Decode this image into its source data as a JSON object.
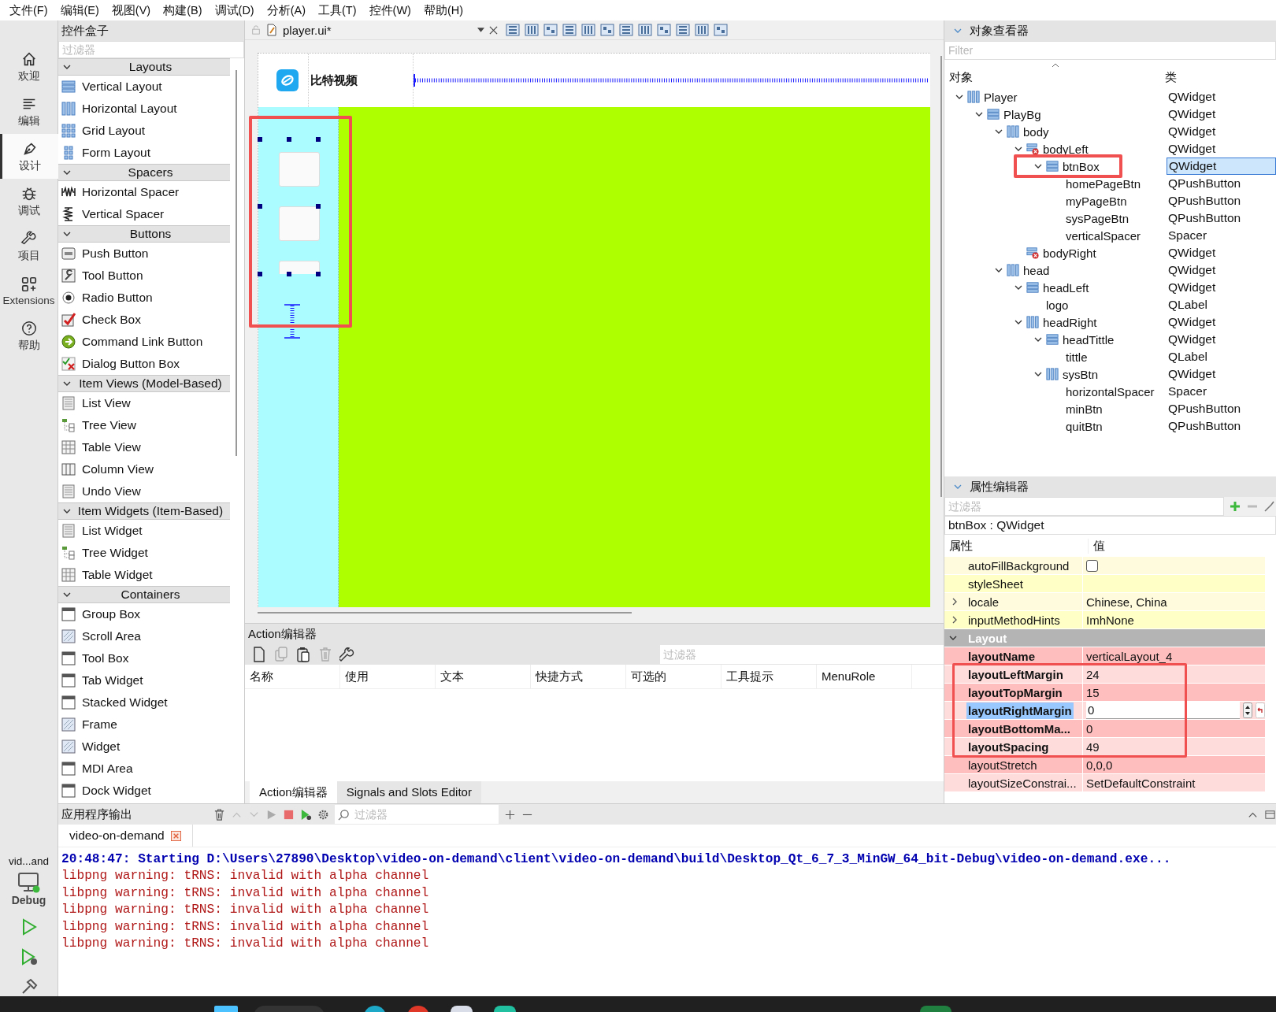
{
  "menu": [
    "文件(F)",
    "编辑(E)",
    "视图(V)",
    "构建(B)",
    "调试(D)",
    "分析(A)",
    "工具(T)",
    "控件(W)",
    "帮助(H)"
  ],
  "mode_bar": {
    "items": [
      {
        "label": "欢迎",
        "kind": "home",
        "selected": false
      },
      {
        "label": "编辑",
        "kind": "edit",
        "selected": false
      },
      {
        "label": "设计",
        "kind": "design",
        "selected": true
      },
      {
        "label": "调试",
        "kind": "debug",
        "selected": false
      },
      {
        "label": "项目",
        "kind": "project",
        "selected": false
      },
      {
        "label": "Extensions",
        "kind": "extensions",
        "selected": false
      },
      {
        "label": "帮助",
        "kind": "help",
        "selected": false
      }
    ],
    "target": "vid...and",
    "build": "Debug"
  },
  "widget_box": {
    "title": "控件盒子",
    "filter": {
      "placeholder": "过滤器"
    },
    "categories": [
      {
        "label": "Layouts",
        "expanded": true,
        "items": [
          {
            "label": "Vertical Layout",
            "kind": "vlayout"
          },
          {
            "label": "Horizontal Layout",
            "kind": "hlayout"
          },
          {
            "label": "Grid Layout",
            "kind": "grid"
          },
          {
            "label": "Form Layout",
            "kind": "form"
          }
        ]
      },
      {
        "label": "Spacers",
        "expanded": true,
        "items": [
          {
            "label": "Horizontal Spacer",
            "kind": "hspacer"
          },
          {
            "label": "Vertical Spacer",
            "kind": "vspacer"
          }
        ]
      },
      {
        "label": "Buttons",
        "expanded": true,
        "items": [
          {
            "label": "Push Button",
            "kind": "push"
          },
          {
            "label": "Tool Button",
            "kind": "tool"
          },
          {
            "label": "Radio Button",
            "kind": "radio"
          },
          {
            "label": "Check Box",
            "kind": "check"
          },
          {
            "label": "Command Link Button",
            "kind": "command"
          },
          {
            "label": "Dialog Button Box",
            "kind": "dialog"
          }
        ]
      },
      {
        "label": "Item Views (Model-Based)",
        "expanded": true,
        "items": [
          {
            "label": "List View",
            "kind": "list"
          },
          {
            "label": "Tree View",
            "kind": "tree"
          },
          {
            "label": "Table View",
            "kind": "table"
          },
          {
            "label": "Column View",
            "kind": "column"
          },
          {
            "label": "Undo View",
            "kind": "list"
          }
        ]
      },
      {
        "label": "Item Widgets (Item-Based)",
        "expanded": true,
        "items": [
          {
            "label": "List Widget",
            "kind": "list"
          },
          {
            "label": "Tree Widget",
            "kind": "tree"
          },
          {
            "label": "Table Widget",
            "kind": "table"
          }
        ]
      },
      {
        "label": "Containers",
        "expanded": true,
        "items": [
          {
            "label": "Group Box",
            "kind": "window"
          },
          {
            "label": "Scroll Area",
            "kind": "frame"
          },
          {
            "label": "Tool Box",
            "kind": "window"
          },
          {
            "label": "Tab Widget",
            "kind": "window"
          },
          {
            "label": "Stacked Widget",
            "kind": "window"
          },
          {
            "label": "Frame",
            "kind": "frame"
          },
          {
            "label": "Widget",
            "kind": "frame"
          },
          {
            "label": "MDI Area",
            "kind": "window"
          },
          {
            "label": "Dock Widget",
            "kind": "window"
          }
        ]
      }
    ]
  },
  "form_editor": {
    "file_tab": "player.ui*",
    "form": {
      "title": "比特视频"
    }
  },
  "action_editor": {
    "title": "Action编辑器",
    "filter": {
      "placeholder": "过滤器"
    },
    "columns": [
      "名称",
      "使用",
      "文本",
      "快捷方式",
      "可选的",
      "工具提示",
      "MenuRole"
    ],
    "tabs": [
      {
        "label": "Action编辑器",
        "selected": true
      },
      {
        "label": "Signals and Slots Editor",
        "selected": false
      }
    ]
  },
  "object_inspector": {
    "title": "对象查看器",
    "filter": {
      "placeholder": "Filter"
    },
    "columns": [
      "对象",
      "类"
    ],
    "tree": [
      {
        "name": "Player",
        "class": "QWidget",
        "kind": "horizontal",
        "expanded": true,
        "selected": false,
        "children": [
          {
            "name": "PlayBg",
            "class": "QWidget",
            "kind": "vertical",
            "expanded": true,
            "selected": false,
            "children": [
              {
                "name": "body",
                "class": "QWidget",
                "kind": "horizontal",
                "expanded": true,
                "selected": false,
                "children": [
                  {
                    "name": "bodyLeft",
                    "class": "QWidget",
                    "kind": "broken",
                    "expanded": true,
                    "selected": false,
                    "children": [
                      {
                        "name": "btnBox",
                        "class": "QWidget",
                        "kind": "vertical",
                        "expanded": true,
                        "selected": true,
                        "children": [
                          {
                            "name": "homePageBtn",
                            "class": "QPushButton",
                            "selected": false
                          },
                          {
                            "name": "myPageBtn",
                            "class": "QPushButton",
                            "selected": false
                          },
                          {
                            "name": "sysPageBtn",
                            "class": "QPushButton",
                            "selected": false
                          },
                          {
                            "name": "verticalSpacer",
                            "class": "Spacer",
                            "selected": false
                          }
                        ]
                      }
                    ]
                  },
                  {
                    "name": "bodyRight",
                    "class": "QWidget",
                    "kind": "broken",
                    "selected": false
                  }
                ]
              },
              {
                "name": "head",
                "class": "QWidget",
                "kind": "horizontal",
                "expanded": true,
                "selected": false,
                "children": [
                  {
                    "name": "headLeft",
                    "class": "QWidget",
                    "kind": "vertical",
                    "expanded": true,
                    "selected": false,
                    "children": [
                      {
                        "name": "logo",
                        "class": "QLabel",
                        "selected": false
                      }
                    ]
                  },
                  {
                    "name": "headRight",
                    "class": "QWidget",
                    "kind": "horizontal",
                    "expanded": true,
                    "selected": false,
                    "children": [
                      {
                        "name": "headTittle",
                        "class": "QWidget",
                        "kind": "vertical",
                        "expanded": true,
                        "selected": false,
                        "children": [
                          {
                            "name": "tittle",
                            "class": "QLabel",
                            "selected": false
                          }
                        ]
                      },
                      {
                        "name": "sysBtn",
                        "class": "QWidget",
                        "kind": "horizontal",
                        "expanded": true,
                        "selected": false,
                        "children": [
                          {
                            "name": "horizontalSpacer",
                            "class": "Spacer",
                            "selected": false
                          },
                          {
                            "name": "minBtn",
                            "class": "QPushButton",
                            "selected": false
                          },
                          {
                            "name": "quitBtn",
                            "class": "QPushButton",
                            "selected": false
                          }
                        ]
                      }
                    ]
                  }
                ]
              }
            ]
          }
        ]
      }
    ]
  },
  "property_editor": {
    "title": "属性编辑器",
    "filter": {
      "placeholder": "过滤器"
    },
    "object": "btnBox : QWidget",
    "columns": [
      "属性",
      "值"
    ],
    "rows": [
      {
        "kind": "bool",
        "name": "autoFillBackground",
        "checked": false,
        "modified": false,
        "expandable": false,
        "color": "#fffbdc",
        "selected": false
      },
      {
        "kind": "text",
        "name": "styleSheet",
        "modified": false,
        "expandable": false,
        "color": "#ffffc6",
        "selected": false
      },
      {
        "kind": "text",
        "name": "locale",
        "value": "Chinese, China",
        "modified": false,
        "expandable": true,
        "color": "#fffbdc",
        "selected": false
      },
      {
        "kind": "text",
        "name": "inputMethodHints",
        "value": "ImhNone",
        "modified": false,
        "expandable": true,
        "color": "#ffffc6",
        "selected": false
      },
      {
        "kind": "group",
        "name": "Layout",
        "expanded": true,
        "color": "#b4b4b4",
        "selected": false
      },
      {
        "kind": "text",
        "name": "layoutName",
        "value": "verticalLayout_4",
        "modified": true,
        "expandable": false,
        "color": "#ffbebe",
        "selected": false
      },
      {
        "kind": "text",
        "name": "layoutLeftMargin",
        "value": "24",
        "modified": true,
        "expandable": false,
        "color": "#ffdcdc",
        "selected": false
      },
      {
        "kind": "text",
        "name": "layoutTopMargin",
        "value": "15",
        "modified": true,
        "expandable": false,
        "color": "#ffbebe",
        "selected": false
      },
      {
        "kind": "text",
        "name": "layoutRightMargin",
        "value": "0",
        "modified": true,
        "expandable": false,
        "color": "#ffdcdc",
        "selected": true
      },
      {
        "kind": "text",
        "name": "layoutBottomMa...",
        "value": "0",
        "modified": true,
        "expandable": false,
        "color": "#ffbebe",
        "selected": false
      },
      {
        "kind": "text",
        "name": "layoutSpacing",
        "value": "49",
        "modified": true,
        "expandable": false,
        "color": "#ffdcdc",
        "selected": false
      },
      {
        "kind": "text",
        "name": "layoutStretch",
        "value": "0,0,0",
        "modified": false,
        "expandable": false,
        "color": "#ffbebe",
        "selected": false
      },
      {
        "kind": "text",
        "name": "layoutSizeConstrai...",
        "value": "SetDefaultConstraint",
        "modified": false,
        "expandable": false,
        "color": "#ffdcdc",
        "selected": false
      }
    ]
  },
  "output": {
    "title": "应用程序输出",
    "filter": {
      "placeholder": "过滤器"
    },
    "tab": "video-on-demand",
    "lines": [
      {
        "kind": "info",
        "text": "20:48:47: Starting D:\\Users\\27890\\Desktop\\video-on-demand\\client\\video-on-demand\\build\\Desktop_Qt_6_7_3_MinGW_64_bit-Debug\\video-on-demand.exe..."
      },
      {
        "kind": "warning",
        "text": "libpng warning: tRNS: invalid with alpha channel"
      },
      {
        "kind": "warning",
        "text": "libpng warning: tRNS: invalid with alpha channel"
      },
      {
        "kind": "warning",
        "text": "libpng warning: tRNS: invalid with alpha channel"
      },
      {
        "kind": "warning",
        "text": "libpng warning: tRNS: invalid with alpha channel"
      },
      {
        "kind": "warning",
        "text": "libpng warning: tRNS: invalid with alpha channel"
      }
    ]
  }
}
